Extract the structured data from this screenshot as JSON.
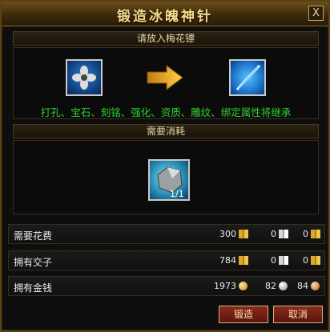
{
  "window": {
    "title": "锻造冰魄神针",
    "close_label": "X"
  },
  "section_insert": {
    "header": "请放入梅花镖",
    "inherit_text": "打孔、宝石、刻铭、强化、资质、雕纹、绑定属性将继承"
  },
  "section_cost": {
    "header": "需要消耗",
    "material_count": "1/1"
  },
  "rows": [
    {
      "label": "需要花费",
      "v1": "300",
      "v2": "0",
      "v3": "0"
    },
    {
      "label": "拥有交子",
      "v1": "784",
      "v2": "0",
      "v3": "0"
    },
    {
      "label": "拥有金钱",
      "v1": "1973",
      "v2": "82",
      "v3": "84"
    }
  ],
  "buttons": {
    "forge": "锻造",
    "cancel": "取消"
  },
  "icons": [
    "close-icon",
    "plum-dart-icon",
    "arrow-icon",
    "ice-needle-icon",
    "forging-stone-icon",
    "gold-book-icon",
    "silver-book-icon",
    "gold-coin-icon",
    "silver-coin-icon",
    "copper-coin-icon"
  ]
}
